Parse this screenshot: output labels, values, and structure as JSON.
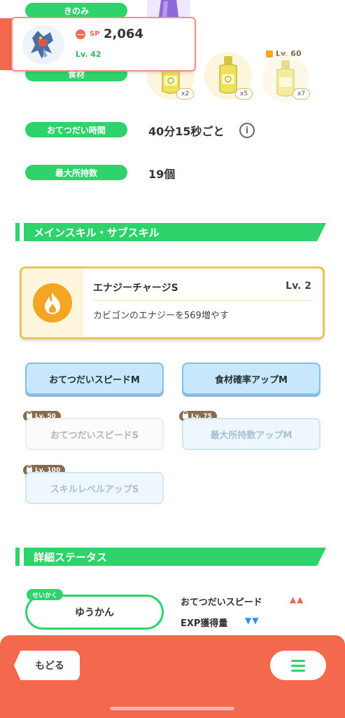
{
  "info_rows": {
    "berry_label": "きのみ",
    "ingredient_label": "食材",
    "help_time_label": "おてつだい時間",
    "help_time_value": "40分15秒ごと",
    "max_carry_label": "最大所持数",
    "max_carry_value": "19個"
  },
  "ingredients": [
    {
      "count": "x2",
      "locked": false,
      "lock_level": ""
    },
    {
      "count": "x5",
      "locked": false,
      "lock_level": ""
    },
    {
      "count": "x7",
      "locked": true,
      "lock_level": "Lv. 60"
    }
  ],
  "popup": {
    "sp_label": "SP",
    "sp_value": "2,064",
    "level": "Lv. 42"
  },
  "sections": {
    "skills_title": "メインスキル・サブスキル",
    "status_title": "詳細ステータス"
  },
  "main_skill": {
    "name": "エナジーチャージS",
    "level": "Lv. 2",
    "description": "カビゴンのエナジーを569増やす",
    "icon": "flame-icon",
    "color": "#f5a524"
  },
  "sub_skills": [
    {
      "label": "おてつだいスピードM",
      "unlocked": true,
      "lock_level": ""
    },
    {
      "label": "食材確率アップM",
      "unlocked": true,
      "lock_level": ""
    },
    {
      "label": "おてつだいスピードS",
      "unlocked": false,
      "lock_level": "Lv. 50"
    },
    {
      "label": "最大所持数アップM",
      "unlocked": false,
      "lock_level": "Lv. 75"
    },
    {
      "label": "スキルレベルアップS",
      "unlocked": false,
      "lock_level": "Lv. 100"
    }
  ],
  "nature": {
    "tag": "せいかく",
    "name": "ゆうかん",
    "up_stat": "おてつだいスピード",
    "up_arrows": "▲▲",
    "down_stat": "EXP獲得量",
    "down_arrows": "▼▼"
  },
  "bottom_bar": {
    "back_label": "もどる",
    "menu_icon": "hamburger-icon"
  },
  "colors": {
    "accent_green": "#2fd36b",
    "bottom_bar": "#f4684e",
    "up_arrow": "#f4684e",
    "down_arrow": "#2d8ff0"
  }
}
